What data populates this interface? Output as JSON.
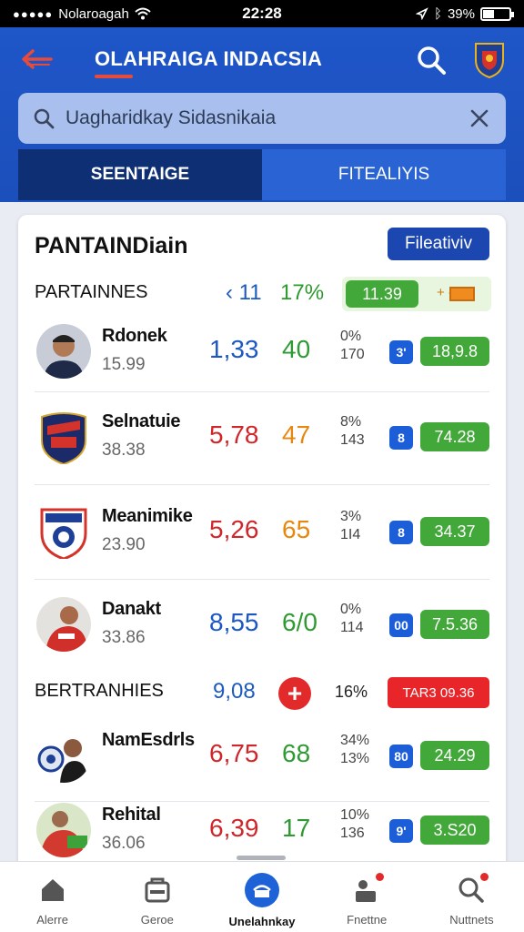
{
  "status_bar": {
    "carrier": "Nolaroagah",
    "time": "22:28",
    "battery": "39%"
  },
  "header": {
    "title": "OLAHRAIGA INDACSIA"
  },
  "search": {
    "placeholder": "Uagharidkay Sidasnikaia"
  },
  "tabs": [
    {
      "label": "SEENTAIGE",
      "active": true
    },
    {
      "label": "FITEALIYIS",
      "active": false
    }
  ],
  "card": {
    "title": "PANTAINDiain",
    "button_label": "Fileativiv",
    "section1": {
      "label": "PARTAINNES",
      "stat_a": "‹ 11",
      "stat_b": "17%",
      "tag": "11.39",
      "mini": "+ ‹"
    },
    "rows1": [
      {
        "name": "Rdonek",
        "sub": "15.99",
        "a": "1,33",
        "a_color": "blue",
        "b": "40",
        "b_color": "green",
        "pct1": "0%",
        "pct2": "170",
        "rank": "3'",
        "score": "18,9.8"
      },
      {
        "name": "Selnatuie",
        "sub": "38.38",
        "a": "5,78",
        "a_color": "red",
        "b": "47",
        "b_color": "orange",
        "pct1": "8%",
        "pct2": "143",
        "rank": "8",
        "score": "74.28"
      },
      {
        "name": "Meanimike",
        "sub": "23.90",
        "a": "5,26",
        "a_color": "red",
        "b": "65",
        "b_color": "orange",
        "pct1": "3%",
        "pct2": "1I4",
        "rank": "8",
        "score": "34.37"
      },
      {
        "name": "Danakt",
        "sub": "33.86",
        "a": "8,55",
        "a_color": "blue",
        "b": "6/0",
        "b_color": "green",
        "pct1": "0%",
        "pct2": "114",
        "rank": "00",
        "score": "7.5.36"
      }
    ],
    "section2": {
      "label": "BERTRANHIES",
      "stat_a": "9,08",
      "add": "+",
      "pct": "16%",
      "tag": "TAR3 09.36"
    },
    "rows2": [
      {
        "name": "NamEsdrls",
        "sub": "",
        "a": "6,75",
        "a_color": "red",
        "b": "68",
        "b_color": "green",
        "pct1": "34%",
        "pct2": "13%",
        "rank": "80",
        "score": "24.29"
      },
      {
        "name": "Rehital",
        "sub": "36.06",
        "a": "6,39",
        "a_color": "red",
        "b": "17",
        "b_color": "green",
        "pct1": "10%",
        "pct2": "136",
        "rank": "9'",
        "score": "3.S20"
      }
    ]
  },
  "bottom_nav": [
    {
      "label": "Alerre",
      "icon": "home-icon"
    },
    {
      "label": "Geroe",
      "icon": "teams-icon"
    },
    {
      "label": "Unelahnkay",
      "icon": "stadium-icon",
      "active": true
    },
    {
      "label": "Fnettne",
      "icon": "players-icon"
    },
    {
      "label": "Nuttnets",
      "icon": "search-alert-icon"
    }
  ],
  "colors": {
    "header": "#1f56c8",
    "tab_active": "#0e2f74",
    "accent_green": "#43a83a",
    "accent_red": "#e32a2a"
  }
}
